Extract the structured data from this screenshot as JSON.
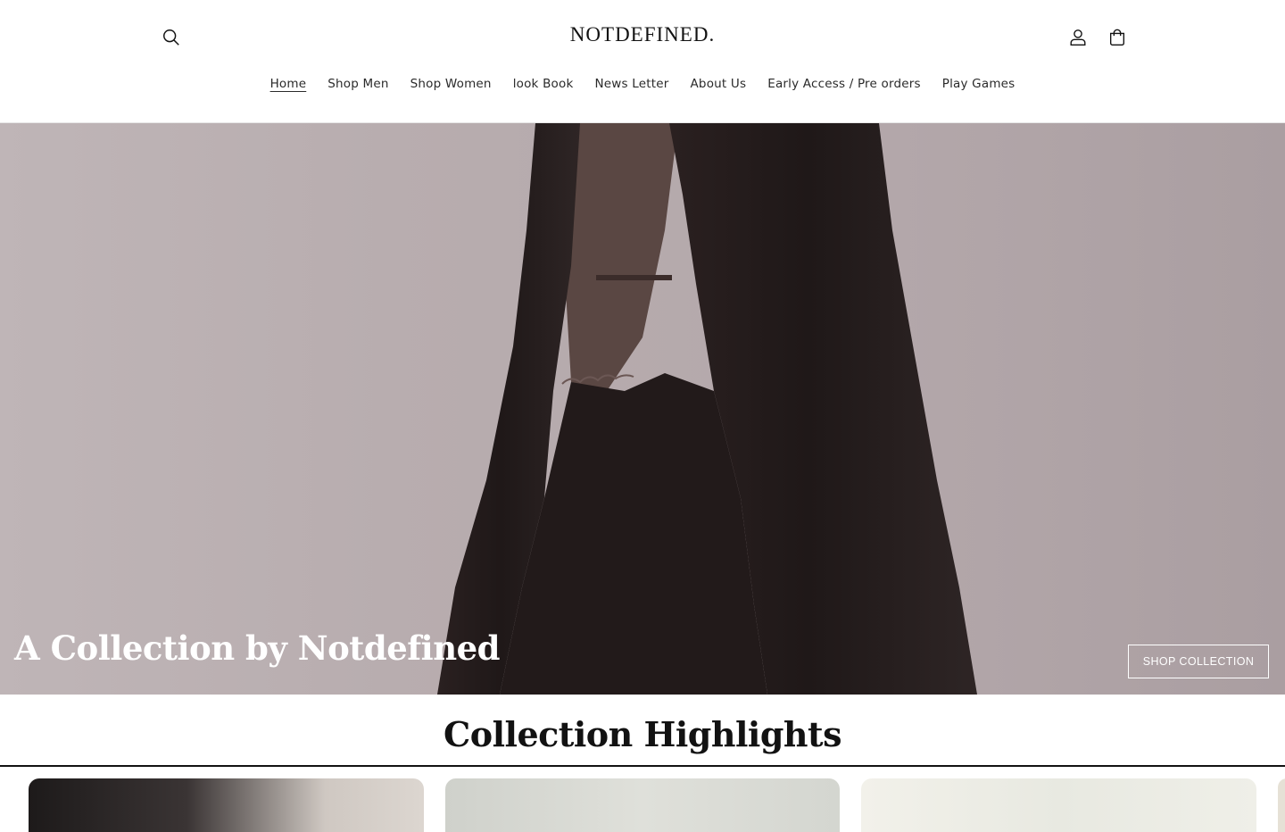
{
  "header": {
    "logo": "NOTDEFINED.",
    "nav": [
      {
        "label": "Home",
        "active": true
      },
      {
        "label": "Shop Men"
      },
      {
        "label": "Shop Women"
      },
      {
        "label": "look Book"
      },
      {
        "label": "News Letter"
      },
      {
        "label": "About Us"
      },
      {
        "label": "Early Access / Pre orders"
      },
      {
        "label": "Play Games"
      }
    ],
    "icons": {
      "search": "search-icon",
      "account": "account-icon",
      "cart": "cart-icon"
    }
  },
  "hero": {
    "title": "A Collection by Notdefined",
    "button": "SHOP COLLECTION"
  },
  "highlights": {
    "title": "Collection Highlights"
  },
  "colors": {
    "text": "#121212",
    "hero_background": "#b8adaf",
    "garment": "#241c1c"
  }
}
